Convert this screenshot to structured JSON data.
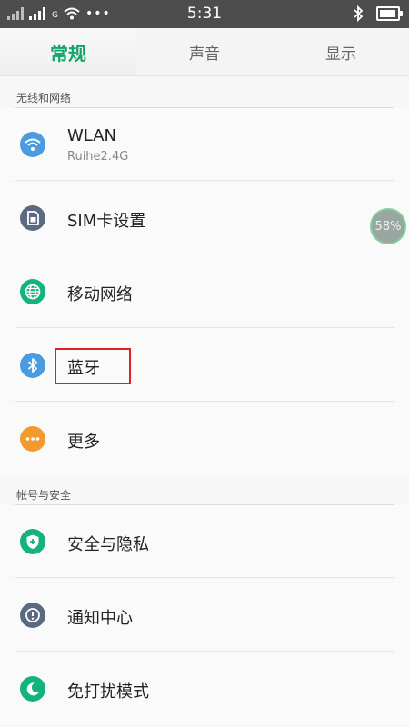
{
  "status_bar": {
    "time": "5:31",
    "network_small": "G",
    "overflow": "•••"
  },
  "tabs": [
    {
      "label": "常规",
      "active": true
    },
    {
      "label": "声音",
      "active": false
    },
    {
      "label": "显示",
      "active": false
    }
  ],
  "sections": [
    {
      "header": "无线和网络",
      "items": [
        {
          "label": "WLAN",
          "sublabel": "Ruihe2.4G",
          "icon": "wifi-icon",
          "icon_color": "#4a9be0"
        },
        {
          "label": "SIM卡设置",
          "icon": "sim-card-icon",
          "icon_color": "#5b6a80"
        },
        {
          "label": "移动网络",
          "icon": "globe-icon",
          "icon_color": "#14b27f"
        },
        {
          "label": "蓝牙",
          "icon": "bluetooth-icon",
          "icon_color": "#4a9be0"
        },
        {
          "label": "更多",
          "icon": "more-icon",
          "icon_color": "#f29a2e"
        }
      ]
    },
    {
      "header": "帐号与安全",
      "items": [
        {
          "label": "安全与隐私",
          "icon": "shield-icon",
          "icon_color": "#14b27f"
        },
        {
          "label": "通知中心",
          "icon": "notification-icon",
          "icon_color": "#5b6a80"
        },
        {
          "label": "免打扰模式",
          "icon": "moon-icon",
          "icon_color": "#14b27f"
        }
      ]
    }
  ],
  "floating_bubble": {
    "text": "58%"
  },
  "battery_level": 0.95
}
